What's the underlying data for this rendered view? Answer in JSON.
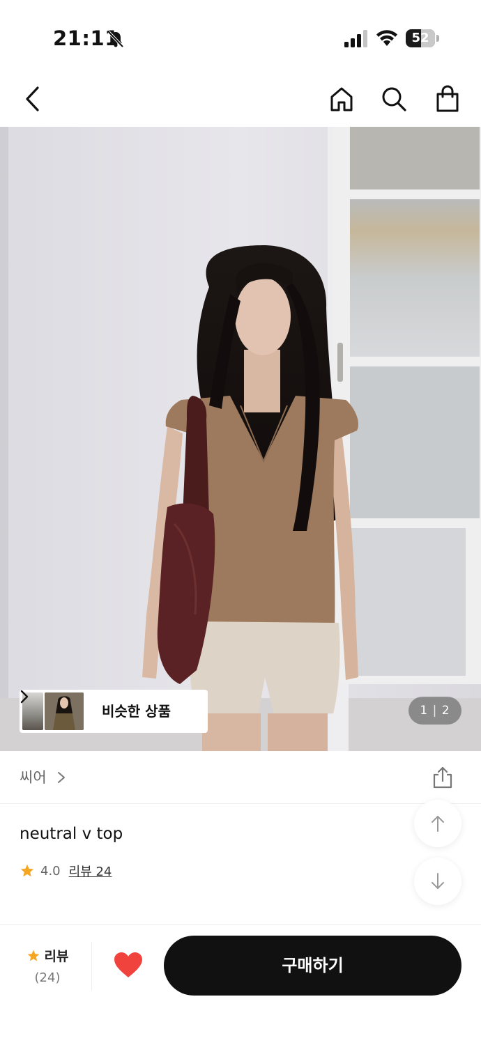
{
  "status_bar": {
    "time": "21:11",
    "battery_percent": "52",
    "battery_level": 0.52,
    "icons": [
      "bell-slash-icon",
      "cellular-signal-icon",
      "wifi-icon",
      "battery-icon"
    ]
  },
  "nav": {
    "icons": [
      "back-chevron-icon",
      "home-icon",
      "search-icon",
      "shopping-bag-icon"
    ]
  },
  "gallery": {
    "similar_label": "비슷한 상품",
    "page_current": "1",
    "page_separator": "|",
    "page_total": "2"
  },
  "brand": {
    "name": "씨어"
  },
  "product": {
    "title": "neutral v top",
    "rating": "4.0",
    "review_link": "리뷰 24"
  },
  "bottom_bar": {
    "review_label": "리뷰",
    "review_count": "(24)",
    "buy_label": "구매하기"
  },
  "colors": {
    "accent_star": "#F5A623",
    "like_heart": "#F0433E",
    "buy_button": "#111111"
  }
}
